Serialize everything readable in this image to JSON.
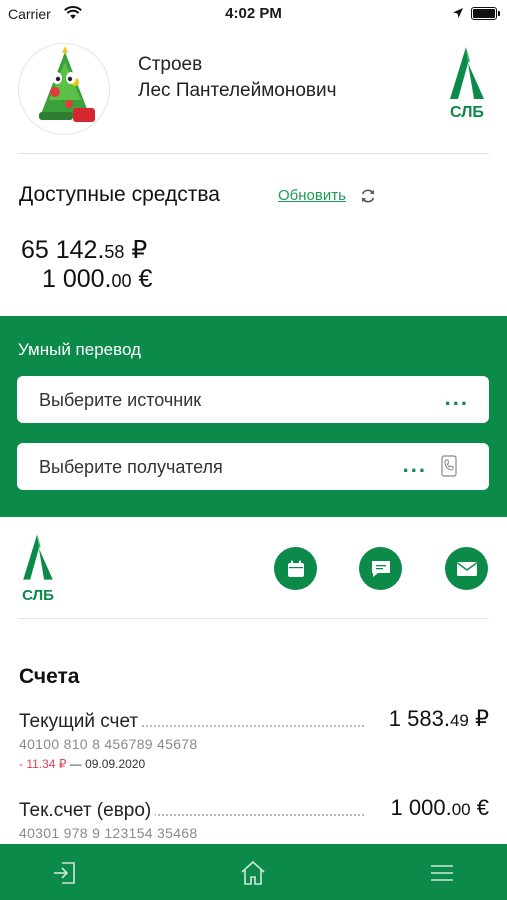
{
  "status_bar": {
    "carrier": "Carrier",
    "time": "4:02 PM"
  },
  "profile": {
    "last_name": "Строев",
    "first_middle": "Лес Пантелеймонович",
    "logo_text": "СЛБ"
  },
  "funds": {
    "title": "Доступные средства",
    "refresh_label": "Обновить",
    "rub_main": "65 142.",
    "rub_cents": "58",
    "rub_symbol": " ₽",
    "eur_main": "1 000.",
    "eur_cents": "00",
    "eur_symbol": " €"
  },
  "transfer": {
    "title": "Умный перевод",
    "source_label": "Выберите источник",
    "recipient_label": "Выберите получателя",
    "more_glyph": "..."
  },
  "quick_actions": {
    "logo_text": "СЛБ",
    "items": [
      "calendar-icon",
      "chat-icon",
      "mail-icon"
    ]
  },
  "accounts": {
    "title": "Счета",
    "items": [
      {
        "name": "Текущий счет",
        "balance_main": "1 583.",
        "balance_cents": "49",
        "currency": " ₽",
        "number": "40100 810 8 456789 45678",
        "change": "- 11.34 ₽",
        "change_date": " — 09.09.2020"
      },
      {
        "name": "Тек.счет (евро)",
        "balance_main": "1 000.",
        "balance_cents": "00",
        "currency": " €",
        "number": "40301 978 9 123154 35468"
      }
    ]
  },
  "bottom_nav": {
    "items": [
      "logout-icon",
      "home-icon",
      "menu-icon"
    ]
  },
  "colors": {
    "brand_green": "#0b8a4a",
    "link_green": "#1e9a56",
    "negative_red": "#e0425a"
  }
}
